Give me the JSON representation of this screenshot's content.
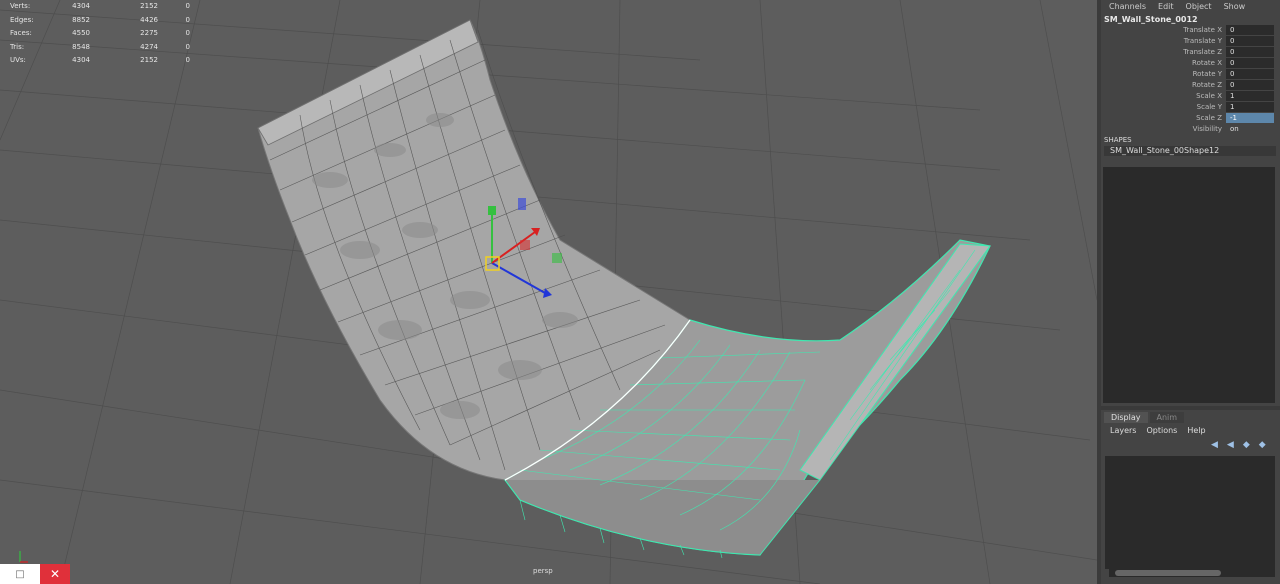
{
  "hud": {
    "rows": [
      {
        "label": "Verts:",
        "a": "4304",
        "b": "2152",
        "c": "0"
      },
      {
        "label": "Edges:",
        "a": "8852",
        "b": "4426",
        "c": "0"
      },
      {
        "label": "Faces:",
        "a": "4550",
        "b": "2275",
        "c": "0"
      },
      {
        "label": "Tris:",
        "a": "8548",
        "b": "4274",
        "c": "0"
      },
      {
        "label": "UVs:",
        "a": "4304",
        "b": "2152",
        "c": "0"
      }
    ]
  },
  "viewport": {
    "camera": "persp"
  },
  "colors": {
    "wire": "#3fe8b0",
    "mesh": "#a6a6a6",
    "viewport_bg": "#5d5d5d",
    "selected": "#5d87ab"
  },
  "channel_box": {
    "menu": [
      "Channels",
      "Edit",
      "Object",
      "Show"
    ],
    "object_name": "SM_Wall_Stone_0012",
    "channels": [
      {
        "label": "Translate X",
        "value": "0"
      },
      {
        "label": "Translate Y",
        "value": "0"
      },
      {
        "label": "Translate Z",
        "value": "0"
      },
      {
        "label": "Rotate X",
        "value": "0"
      },
      {
        "label": "Rotate Y",
        "value": "0"
      },
      {
        "label": "Rotate Z",
        "value": "0"
      },
      {
        "label": "Scale X",
        "value": "1"
      },
      {
        "label": "Scale Y",
        "value": "1"
      },
      {
        "label": "Scale Z",
        "value": "-1"
      },
      {
        "label": "Visibility",
        "value": "on"
      }
    ],
    "shapes_header": "SHAPES",
    "shape_name": "SM_Wall_Stone_00Shape12"
  },
  "layers": {
    "tabs": [
      "Display",
      "Anim"
    ],
    "menu": [
      "Layers",
      "Options",
      "Help"
    ]
  },
  "icons": [
    "move-manipulator-icon",
    "layer-new-icon",
    "layer-selected-icon"
  ]
}
